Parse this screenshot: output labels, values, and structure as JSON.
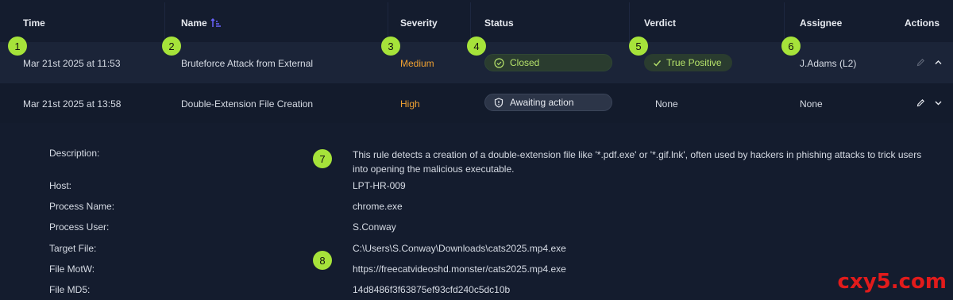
{
  "columns": {
    "time": "Time",
    "name": "Name",
    "severity": "Severity",
    "status": "Status",
    "verdict": "Verdict",
    "assignee": "Assignee",
    "actions": "Actions"
  },
  "rows": [
    {
      "time": "Mar 21st 2025 at 11:53",
      "name": "Bruteforce Attack from External",
      "severity": "Medium",
      "status": "Closed",
      "verdict": "True Positive",
      "assignee": "J.Adams (L2)"
    },
    {
      "time": "Mar 21st 2025 at 13:58",
      "name": "Double-Extension File Creation",
      "severity": "High",
      "status": "Awaiting action",
      "verdict": "None",
      "assignee": "None"
    }
  ],
  "details": {
    "description_label": "Description:",
    "description": "This rule detects a creation of a double-extension file like '*.pdf.exe' or '*.gif.lnk', often used by hackers in phishing attacks to trick users into opening the malicious executable.",
    "fields": [
      {
        "label": "Host:",
        "value": "LPT-HR-009"
      },
      {
        "label": "Process Name:",
        "value": "chrome.exe"
      },
      {
        "label": "Process User:",
        "value": "S.Conway"
      },
      {
        "label": "Target File:",
        "value": "C:\\Users\\S.Conway\\Downloads\\cats2025.mp4.exe"
      },
      {
        "label": "File MotW:",
        "value": "https://freecatvideoshd.monster/cats2025.mp4.exe"
      },
      {
        "label": "File MD5:",
        "value": "14d8486f3f63875ef93cfd240c5dc10b"
      }
    ]
  },
  "markers": [
    "1",
    "2",
    "3",
    "4",
    "5",
    "6",
    "7",
    "8"
  ],
  "watermark": "cxy5.com",
  "colors": {
    "accent_green": "#a6e33a",
    "severity_orange": "#f0a132",
    "sort_icon_blue": "#6b63ff",
    "watermark_red": "#e21b1b"
  },
  "icons": [
    "sort-ascending-icon",
    "check-circle-icon",
    "shield-icon",
    "check-icon",
    "edit-pencil-icon",
    "chevron-up-icon",
    "chevron-down-icon"
  ]
}
